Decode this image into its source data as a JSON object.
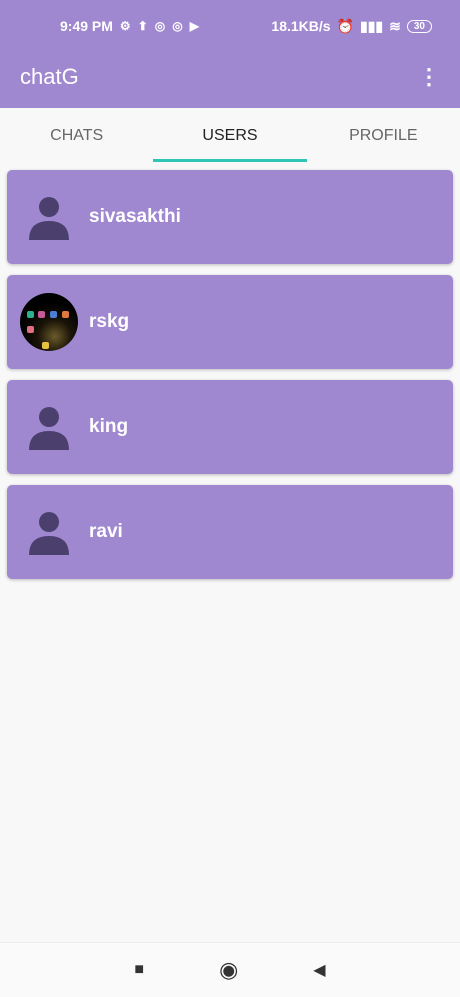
{
  "status": {
    "time": "9:49 PM",
    "net_speed": "18.1KB/s",
    "battery": "30"
  },
  "appbar": {
    "title": "chatG"
  },
  "tabs": [
    {
      "label": "CHATS"
    },
    {
      "label": "USERS",
      "active": true
    },
    {
      "label": "PROFILE"
    }
  ],
  "users": [
    {
      "name": "sivasakthi",
      "avatar": "person-icon"
    },
    {
      "name": "rskg",
      "avatar": "photo"
    },
    {
      "name": "king",
      "avatar": "person-icon"
    },
    {
      "name": "ravi",
      "avatar": "person-icon"
    }
  ],
  "colors": {
    "primary": "#9f88d0",
    "accent": "#2ec4b6",
    "avatar_icon": "#4b3f6e"
  }
}
